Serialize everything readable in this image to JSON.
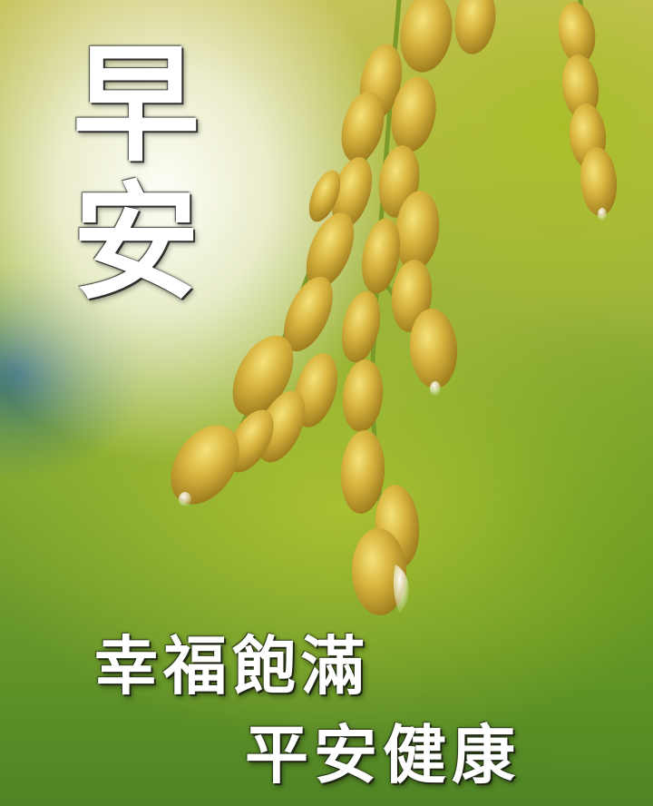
{
  "greeting": {
    "char_1": "早",
    "char_2": "安"
  },
  "blessings": {
    "line_1": "幸福飽滿",
    "line_2": "平安健康"
  },
  "scene": {
    "subject": "rice-panicle-icon",
    "grain_color": "#d6b23c",
    "stem_color": "#7c9a28"
  }
}
